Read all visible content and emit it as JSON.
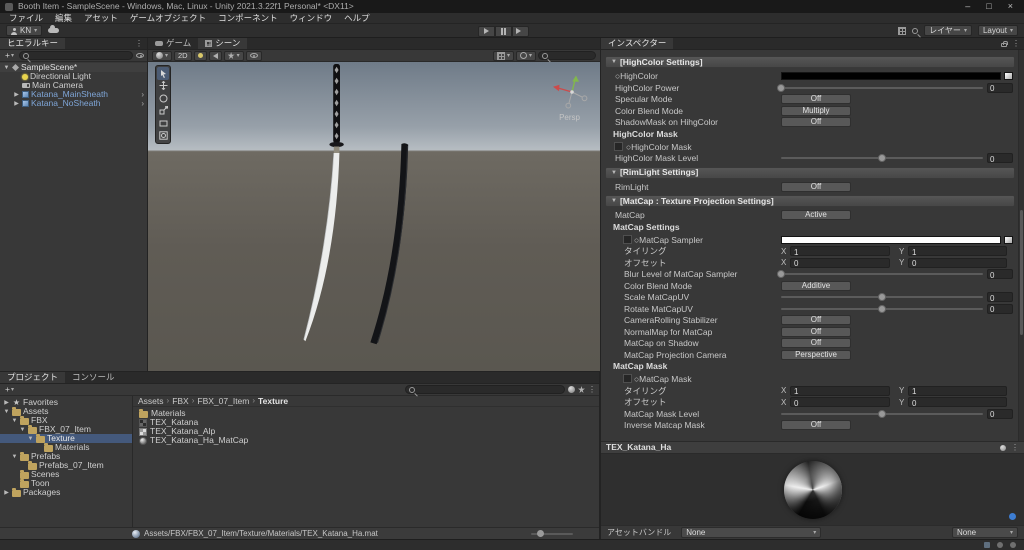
{
  "window": {
    "title": "Booth Item - SampleScene - Windows, Mac, Linux - Unity 2021.3.22f1 Personal* <DX11>"
  },
  "icons": {
    "minimize": "–",
    "maximize": "□",
    "close": "×",
    "caret": "▾",
    "menu": "⋮",
    "plus": "+",
    "fold_open": "▼",
    "fold_closed": "▶",
    "prefab_arrow": "›",
    "star": "★"
  },
  "menubar": {
    "items": [
      "ファイル",
      "編集",
      "アセット",
      "ゲームオブジェクト",
      "コンポーネント",
      "ウィンドウ",
      "ヘルプ"
    ]
  },
  "toolbar": {
    "account_label": "KN",
    "layers_label": "レイヤー",
    "layout_label": "Layout"
  },
  "hierarchy": {
    "tab": "ヒエラルキー",
    "items": [
      {
        "label": "SampleScene*",
        "icon": "scene",
        "depth": 0,
        "arrow": "open",
        "sceneRow": true
      },
      {
        "label": "Directional Light",
        "icon": "light",
        "depth": 1,
        "arrow": ""
      },
      {
        "label": "Main Camera",
        "icon": "camera",
        "depth": 1,
        "arrow": ""
      },
      {
        "label": "Katana_MainSheath",
        "icon": "prefab",
        "depth": 1,
        "arrow": "closed",
        "prefab": true,
        "openArrow": true
      },
      {
        "label": "Katana_NoSheath",
        "icon": "prefab",
        "depth": 1,
        "arrow": "closed",
        "prefab": true,
        "openArrow": true
      }
    ]
  },
  "scene_view": {
    "tab_game": "ゲーム",
    "tab_scene": "シーン",
    "mode_2d": "2D",
    "persp": "Persp"
  },
  "inspector": {
    "tab": "インスペクター",
    "axis_x": "X",
    "axis_y": "Y",
    "rows": [
      {
        "type": "foldout",
        "label": "[HighColor Settings]"
      },
      {
        "type": "color",
        "label": "○HighColor",
        "swatch": "#000000"
      },
      {
        "type": "slider",
        "label": "HighColor Power",
        "value": "0",
        "pos": 0
      },
      {
        "type": "button",
        "label": "Specular Mode",
        "button": "Off"
      },
      {
        "type": "button",
        "label": "Color Blend Mode",
        "button": "Multiply"
      },
      {
        "type": "button",
        "label": "ShadowMask on HihgColor",
        "button": "Off"
      },
      {
        "type": "bold",
        "label": "HighColor Mask"
      },
      {
        "type": "tex",
        "label": "○HighColor Mask"
      },
      {
        "type": "slider",
        "label": "HighColor Mask Level",
        "value": "0",
        "pos": 50
      },
      {
        "type": "foldout",
        "label": "[RimLight Settings]"
      },
      {
        "type": "button",
        "label": "RimLight",
        "button": "Off"
      },
      {
        "type": "foldout",
        "label": "[MatCap : Texture Projection Settings]"
      },
      {
        "type": "button",
        "label": "MatCap",
        "button": "Active"
      },
      {
        "type": "bold",
        "label": "MatCap Settings"
      },
      {
        "type": "color",
        "label": "○MatCap Sampler",
        "swatch": "#FFFFFF",
        "thumb": true,
        "indent": 1
      },
      {
        "type": "xy",
        "label": "タイリング",
        "x": "1",
        "y": "1",
        "indent": 1
      },
      {
        "type": "xy",
        "label": "オフセット",
        "x": "0",
        "y": "0",
        "indent": 1
      },
      {
        "type": "slider",
        "label": "Blur Level of MatCap Sampler",
        "value": "0",
        "pos": 0,
        "indent": 1
      },
      {
        "type": "button",
        "label": "Color Blend Mode",
        "button": "Additive",
        "indent": 1
      },
      {
        "type": "slider",
        "label": "Scale MatCapUV",
        "value": "0",
        "pos": 50,
        "indent": 1
      },
      {
        "type": "slider",
        "label": "Rotate MatCapUV",
        "value": "0",
        "pos": 50,
        "indent": 1
      },
      {
        "type": "button",
        "label": "CameraRolling Stabilizer",
        "button": "Off",
        "indent": 1
      },
      {
        "type": "button",
        "label": "NormalMap for MatCap",
        "button": "Off",
        "indent": 1
      },
      {
        "type": "button",
        "label": "MatCap on Shadow",
        "button": "Off",
        "indent": 1
      },
      {
        "type": "button",
        "label": "MatCap Projection Camera",
        "button": "Perspective",
        "indent": 1
      },
      {
        "type": "bold",
        "label": "MatCap Mask"
      },
      {
        "type": "tex",
        "label": "○MatCap Mask",
        "indent": 1
      },
      {
        "type": "xy",
        "label": "タイリング",
        "x": "1",
        "y": "1",
        "indent": 1
      },
      {
        "type": "xy",
        "label": "オフセット",
        "x": "0",
        "y": "0",
        "indent": 1
      },
      {
        "type": "slider",
        "label": "MatCap Mask Level",
        "value": "0",
        "pos": 50,
        "indent": 1
      },
      {
        "type": "button",
        "label": "Inverse Matcap Mask",
        "button": "Off",
        "indent": 1
      }
    ],
    "preview": {
      "title": "TEX_Katana_Ha",
      "assetbundle_label": "アセットバンドル",
      "bundle_value": "None",
      "variant_value": "None"
    }
  },
  "project": {
    "tab_project": "プロジェクト",
    "tab_console": "コンソール",
    "favorites_label": "Favorites",
    "tree": [
      {
        "label": "Favorites",
        "icon": "star",
        "depth": 0,
        "arrow": "closed"
      },
      {
        "label": "Assets",
        "icon": "folder",
        "depth": 0,
        "arrow": "open"
      },
      {
        "label": "FBX",
        "icon": "folder",
        "depth": 1,
        "arrow": "open"
      },
      {
        "label": "FBX_07_Item",
        "icon": "folder",
        "depth": 2,
        "arrow": "open"
      },
      {
        "label": "Texture",
        "icon": "folder",
        "depth": 3,
        "arrow": "open",
        "selected": true
      },
      {
        "label": "Materials",
        "icon": "folder",
        "depth": 4,
        "arrow": ""
      },
      {
        "label": "Prefabs",
        "icon": "folder",
        "depth": 1,
        "arrow": "open"
      },
      {
        "label": "Prefabs_07_Item",
        "icon": "folder",
        "depth": 2,
        "arrow": ""
      },
      {
        "label": "Scenes",
        "icon": "folder",
        "depth": 1,
        "arrow": ""
      },
      {
        "label": "Toon",
        "icon": "folder",
        "depth": 1,
        "arrow": ""
      },
      {
        "label": "Packages",
        "icon": "folder",
        "depth": 0,
        "arrow": "closed"
      }
    ],
    "breadcrumb": [
      "Assets",
      "FBX",
      "FBX_07_Item",
      "Texture"
    ],
    "files": [
      {
        "label": "Materials",
        "icon": "folder"
      },
      {
        "label": "TEX_Katana",
        "icon": "texd"
      },
      {
        "label": "TEX_Katana_Alp",
        "icon": "texl"
      },
      {
        "label": "TEX_Katana_Ha_MatCap",
        "icon": "texm"
      }
    ],
    "status_path": "Assets/FBX/FBX_07_Item/Texture/Materials/TEX_Katana_Ha.mat"
  }
}
